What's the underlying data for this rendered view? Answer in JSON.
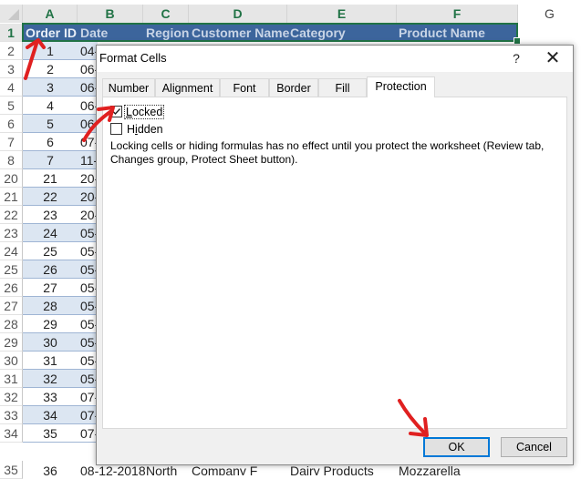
{
  "spreadsheet": {
    "column_headers": [
      "A",
      "B",
      "C",
      "D",
      "E",
      "F",
      "G"
    ],
    "header_row_number": "1",
    "header_cells": [
      "Order ID",
      "Date",
      "Region",
      "Customer Name",
      "Category",
      "Product Name"
    ],
    "rows": [
      {
        "row": "2",
        "id": "1",
        "date": "04-"
      },
      {
        "row": "3",
        "id": "2",
        "date": "06-"
      },
      {
        "row": "4",
        "id": "3",
        "date": "06-"
      },
      {
        "row": "5",
        "id": "4",
        "date": "06-"
      },
      {
        "row": "6",
        "id": "5",
        "date": "06-"
      },
      {
        "row": "7",
        "id": "6",
        "date": "07-"
      },
      {
        "row": "8",
        "id": "7",
        "date": "11-"
      },
      {
        "row": "20",
        "id": "21",
        "date": "20-"
      },
      {
        "row": "21",
        "id": "22",
        "date": "20-"
      },
      {
        "row": "22",
        "id": "23",
        "date": "20-"
      },
      {
        "row": "23",
        "id": "24",
        "date": "05-"
      },
      {
        "row": "24",
        "id": "25",
        "date": "05-"
      },
      {
        "row": "25",
        "id": "26",
        "date": "05-"
      },
      {
        "row": "26",
        "id": "27",
        "date": "05-"
      },
      {
        "row": "27",
        "id": "28",
        "date": "05-"
      },
      {
        "row": "28",
        "id": "29",
        "date": "05-"
      },
      {
        "row": "29",
        "id": "30",
        "date": "05-"
      },
      {
        "row": "30",
        "id": "31",
        "date": "05-"
      },
      {
        "row": "31",
        "id": "32",
        "date": "05-"
      },
      {
        "row": "32",
        "id": "33",
        "date": "07-"
      },
      {
        "row": "33",
        "id": "34",
        "date": "07-"
      },
      {
        "row": "34",
        "id": "35",
        "date": "07-"
      }
    ],
    "last_row": {
      "row": "35",
      "id": "36",
      "date": "08-12-2018",
      "region": "North",
      "customer": "Company F",
      "category": "Dairy Products",
      "product": "Mozzarella"
    }
  },
  "dialog": {
    "title": "Format Cells",
    "help_label": "?",
    "close_label": "✕",
    "tabs": [
      {
        "label": "Number",
        "active": false
      },
      {
        "label": "Alignment",
        "active": false
      },
      {
        "label": "Font",
        "active": false
      },
      {
        "label": "Border",
        "active": false
      },
      {
        "label": "Fill",
        "active": false
      },
      {
        "label": "Protection",
        "active": true
      }
    ],
    "locked": {
      "label": "Locked",
      "checked": true
    },
    "hidden": {
      "label": "Hidden",
      "checked": false
    },
    "info_text": "Locking cells or hiding formulas has no effect until you protect the worksheet (Review tab, Changes group, Protect Sheet button).",
    "ok_label": "OK",
    "cancel_label": "Cancel"
  },
  "colors": {
    "header_fill": "#3c659c",
    "band_fill": "#dce6f2",
    "excel_green": "#217346",
    "annotation_red": "#e02020",
    "default_button_border": "#0078d7"
  }
}
